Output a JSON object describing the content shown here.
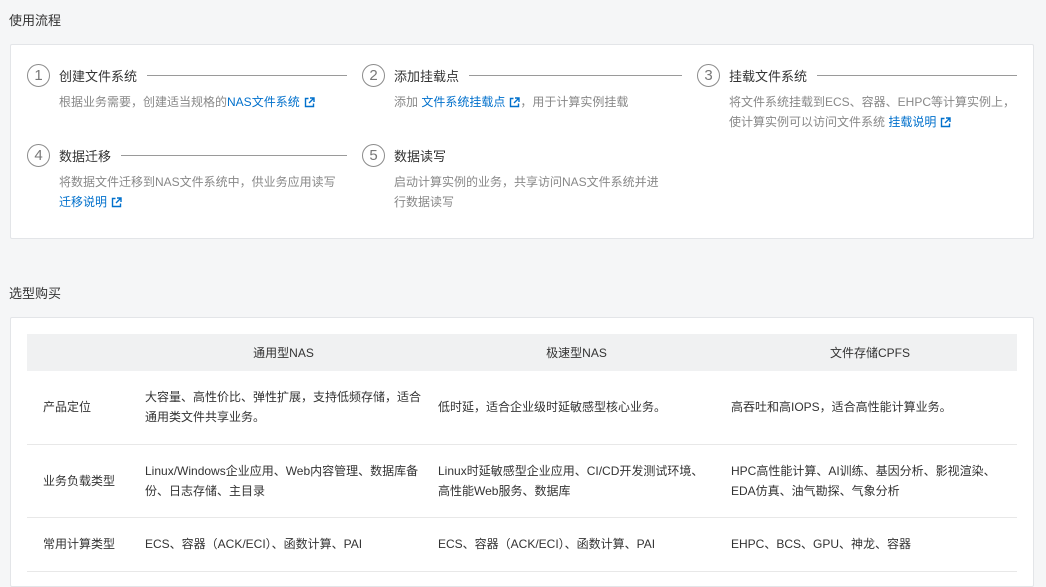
{
  "flow": {
    "title": "使用流程",
    "steps": [
      {
        "num": "1",
        "title": "创建文件系统",
        "pre": "根据业务需要，创建适当规格的",
        "link": "NAS文件系统",
        "post": ""
      },
      {
        "num": "2",
        "title": "添加挂载点",
        "pre": "添加 ",
        "link": "文件系统挂载点",
        "post": "，用于计算实例挂载"
      },
      {
        "num": "3",
        "title": "挂载文件系统",
        "pre": "将文件系统挂载到ECS、容器、EHPC等计算实例上，使计算实例可以访问文件系统 ",
        "link": "挂载说明",
        "post": ""
      },
      {
        "num": "4",
        "title": "数据迁移",
        "pre": "将数据文件迁移到NAS文件系统中，供业务应用读写 ",
        "link": "迁移说明",
        "post": ""
      },
      {
        "num": "5",
        "title": "数据读写",
        "pre": "启动计算实例的业务，共享访问NAS文件系统并进行数据读写",
        "link": "",
        "post": ""
      }
    ]
  },
  "purchase": {
    "title": "选型购买",
    "columns": [
      "",
      "通用型NAS",
      "极速型NAS",
      "文件存储CPFS"
    ],
    "rows": [
      {
        "label": "产品定位",
        "cells": [
          "大容量、高性价比、弹性扩展，支持低频存储，适合通用类文件共享业务。",
          "低时延，适合企业级时延敏感型核心业务。",
          "高吞吐和高IOPS，适合高性能计算业务。"
        ]
      },
      {
        "label": "业务负载类型",
        "cells": [
          "Linux/Windows企业应用、Web内容管理、数据库备份、日志存储、主目录",
          "Linux时延敏感型企业应用、CI/CD开发测试环境、高性能Web服务、数据库",
          "HPC高性能计算、AI训练、基因分析、影视渲染、EDA仿真、油气勘探、气象分析"
        ]
      },
      {
        "label": "常用计算类型",
        "cells": [
          "ECS、容器（ACK/ECI）、函数计算、PAI",
          "ECS、容器（ACK/ECI）、函数计算、PAI",
          "EHPC、BCS、GPU、神龙、容器"
        ]
      }
    ]
  }
}
